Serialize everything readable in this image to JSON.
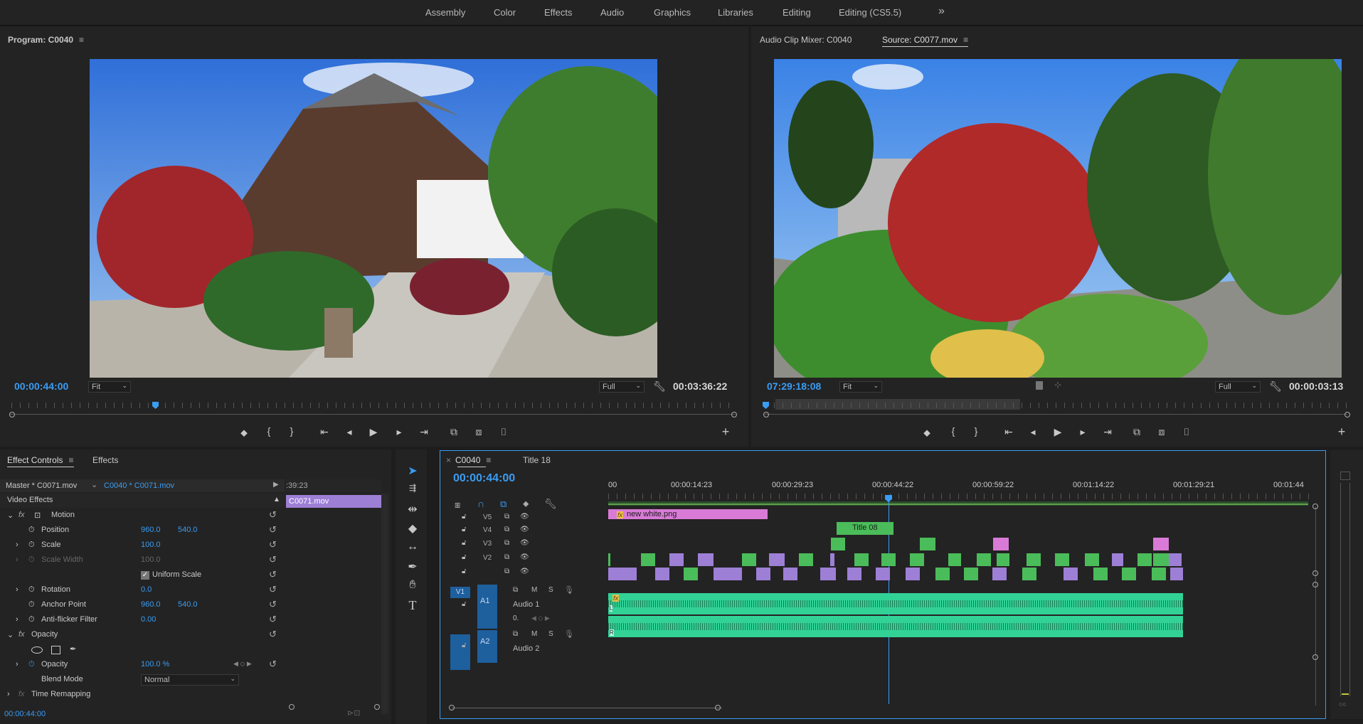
{
  "workspaces": [
    "Assembly",
    "Color",
    "Effects",
    "Audio",
    "Graphics",
    "Libraries",
    "Editing",
    "Editing (CS5.5)"
  ],
  "workspace_more": "»",
  "program": {
    "title": "Program: C0040",
    "timecode": "00:00:44:00",
    "fit": "Fit",
    "quality": "Full",
    "duration": "00:03:36:22"
  },
  "source": {
    "tab_mixer": "Audio Clip Mixer: C0040",
    "tab_source": "Source: C0077.mov",
    "timecode": "07:29:18:08",
    "fit": "Fit",
    "quality": "Full",
    "duration": "00:00:03:13"
  },
  "effect_controls": {
    "tab": "Effect Controls",
    "tab2": "Effects",
    "master": "Master * C0071.mov",
    "sequence_clip": "C0040 * C0071.mov",
    "mini_timecode": ":39:23",
    "mini_clip": "C0071.mov",
    "video_effects": "Video Effects",
    "motion": "Motion",
    "position_label": "Position",
    "position_x": "960.0",
    "position_y": "540.0",
    "scale_label": "Scale",
    "scale": "100.0",
    "scale_width_label": "Scale Width",
    "scale_width": "100.0",
    "uniform_scale": "Uniform Scale",
    "rotation_label": "Rotation",
    "rotation": "0.0",
    "anchor_label": "Anchor Point",
    "anchor_x": "960.0",
    "anchor_y": "540.0",
    "antiflicker_label": "Anti-flicker Filter",
    "antiflicker": "0.00",
    "opacity_section": "Opacity",
    "opacity_label": "Opacity",
    "opacity": "100.0 %",
    "blend_label": "Blend Mode",
    "blend": "Normal",
    "time_remap": "Time Remapping",
    "bottom_timecode": "00:00:44:00"
  },
  "timeline": {
    "tab": "C0040",
    "tab2": "Title 18",
    "timecode": "00:00:44:00",
    "ruler": [
      "00",
      "00:00:14:23",
      "00:00:29:23",
      "00:00:44:22",
      "00:00:59:22",
      "00:01:14:22",
      "00:01:29:21",
      "00:01:44"
    ],
    "tracks_video": [
      "V5",
      "V4",
      "V3",
      "V2",
      "V1"
    ],
    "source_patch": "V1",
    "tracks_audio": [
      "A1",
      "A2"
    ],
    "audio1_name": "Audio 1",
    "audio2_name": "Audio 2",
    "clip_v5": "new white.png",
    "clip_v4": "Title 08",
    "mute": "M",
    "solo": "S",
    "fx_badge": "fx",
    "audio_channel_l": "L",
    "audio_channel_r": "R",
    "volume_value": "0."
  },
  "colors": {
    "accent": "#3a9cf3",
    "green_clip": "#4bbc5a",
    "violet_clip": "#9d7fd6",
    "pink_clip": "#d97bd6",
    "audio_clip": "#32d296"
  }
}
